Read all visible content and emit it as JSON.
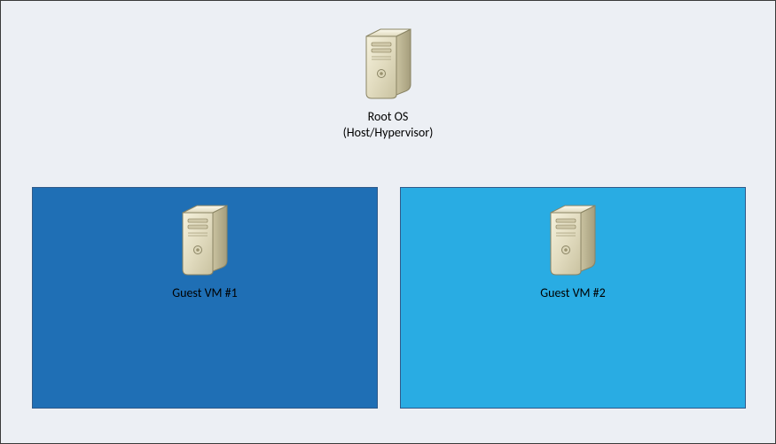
{
  "root": {
    "label_line1": "Root OS",
    "label_line2": "(Host/Hypervisor)",
    "icon": "server-tower-icon"
  },
  "guests": [
    {
      "label": "Guest VM #1",
      "icon": "server-tower-icon",
      "panel_color": "#1f6fb5"
    },
    {
      "label": "Guest VM #2",
      "icon": "server-tower-icon",
      "panel_color": "#29ace3"
    }
  ],
  "colors": {
    "canvas_bg": "#eceff4",
    "canvas_border": "#3a3a3a",
    "panel_border": "#2f5a8a"
  }
}
